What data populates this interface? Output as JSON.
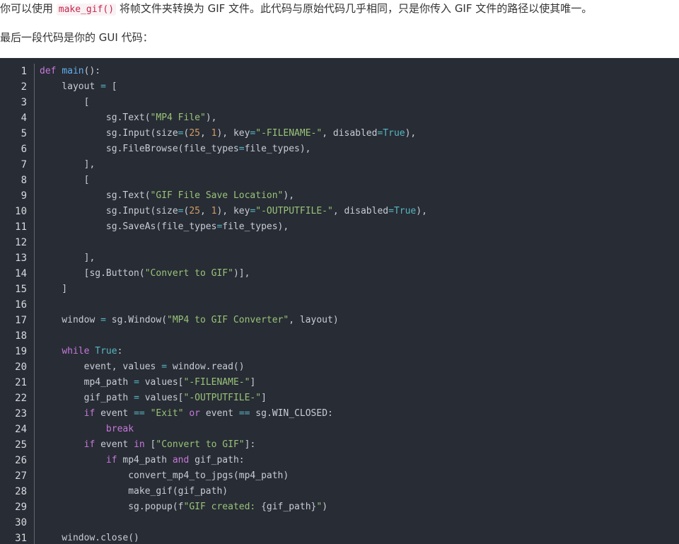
{
  "intro": {
    "before": "你可以使用 ",
    "code": "make_gif()",
    "after": " 将帧文件夹转换为 GIF 文件。此代码与原始代码几乎相同，只是你传入 GIF 文件的路径以使其唯一。"
  },
  "lead": "最后一段代码是你的 GUI 代码：",
  "code_lines": [
    [
      [
        "kw",
        "def"
      ],
      [
        "t",
        " "
      ],
      [
        "fn",
        "main"
      ],
      [
        "t",
        "():"
      ]
    ],
    [
      [
        "t",
        "    layout "
      ],
      [
        "op",
        "="
      ],
      [
        "t",
        " ["
      ]
    ],
    [
      [
        "t",
        "        ["
      ]
    ],
    [
      [
        "t",
        "            sg.Text("
      ],
      [
        "str",
        "\"MP4 File\""
      ],
      [
        "t",
        "),"
      ]
    ],
    [
      [
        "t",
        "            sg.Input(size"
      ],
      [
        "op",
        "="
      ],
      [
        "t",
        "("
      ],
      [
        "num",
        "25"
      ],
      [
        "t",
        ", "
      ],
      [
        "num",
        "1"
      ],
      [
        "t",
        "), key"
      ],
      [
        "op",
        "="
      ],
      [
        "str",
        "\"-FILENAME-\""
      ],
      [
        "t",
        ", disabled"
      ],
      [
        "op",
        "="
      ],
      [
        "bool",
        "True"
      ],
      [
        "t",
        "),"
      ]
    ],
    [
      [
        "t",
        "            sg.FileBrowse(file_types"
      ],
      [
        "op",
        "="
      ],
      [
        "t",
        "file_types),"
      ]
    ],
    [
      [
        "t",
        "        ],"
      ]
    ],
    [
      [
        "t",
        "        ["
      ]
    ],
    [
      [
        "t",
        "            sg.Text("
      ],
      [
        "str",
        "\"GIF File Save Location\""
      ],
      [
        "t",
        "),"
      ]
    ],
    [
      [
        "t",
        "            sg.Input(size"
      ],
      [
        "op",
        "="
      ],
      [
        "t",
        "("
      ],
      [
        "num",
        "25"
      ],
      [
        "t",
        ", "
      ],
      [
        "num",
        "1"
      ],
      [
        "t",
        "), key"
      ],
      [
        "op",
        "="
      ],
      [
        "str",
        "\"-OUTPUTFILE-\""
      ],
      [
        "t",
        ", disabled"
      ],
      [
        "op",
        "="
      ],
      [
        "bool",
        "True"
      ],
      [
        "t",
        "),"
      ]
    ],
    [
      [
        "t",
        "            sg.SaveAs(file_types"
      ],
      [
        "op",
        "="
      ],
      [
        "t",
        "file_types),"
      ]
    ],
    [
      [
        "t",
        ""
      ]
    ],
    [
      [
        "t",
        "        ],"
      ]
    ],
    [
      [
        "t",
        "        [sg.Button("
      ],
      [
        "str",
        "\"Convert to GIF\""
      ],
      [
        "t",
        ")],"
      ]
    ],
    [
      [
        "t",
        "    ]"
      ]
    ],
    [
      [
        "t",
        ""
      ]
    ],
    [
      [
        "t",
        "    window "
      ],
      [
        "op",
        "="
      ],
      [
        "t",
        " sg.Window("
      ],
      [
        "str",
        "\"MP4 to GIF Converter\""
      ],
      [
        "t",
        ", layout)"
      ]
    ],
    [
      [
        "t",
        ""
      ]
    ],
    [
      [
        "t",
        "    "
      ],
      [
        "kw",
        "while"
      ],
      [
        "t",
        " "
      ],
      [
        "bool",
        "True"
      ],
      [
        "t",
        ":"
      ]
    ],
    [
      [
        "t",
        "        event, values "
      ],
      [
        "op",
        "="
      ],
      [
        "t",
        " window.read()"
      ]
    ],
    [
      [
        "t",
        "        mp4_path "
      ],
      [
        "op",
        "="
      ],
      [
        "t",
        " values["
      ],
      [
        "str",
        "\"-FILENAME-\""
      ],
      [
        "t",
        "]"
      ]
    ],
    [
      [
        "t",
        "        gif_path "
      ],
      [
        "op",
        "="
      ],
      [
        "t",
        " values["
      ],
      [
        "str",
        "\"-OUTPUTFILE-\""
      ],
      [
        "t",
        "]"
      ]
    ],
    [
      [
        "t",
        "        "
      ],
      [
        "kw",
        "if"
      ],
      [
        "t",
        " event "
      ],
      [
        "op",
        "=="
      ],
      [
        "t",
        " "
      ],
      [
        "str",
        "\"Exit\""
      ],
      [
        "t",
        " "
      ],
      [
        "kw",
        "or"
      ],
      [
        "t",
        " event "
      ],
      [
        "op",
        "=="
      ],
      [
        "t",
        " sg.WIN_CLOSED:"
      ]
    ],
    [
      [
        "t",
        "            "
      ],
      [
        "kw",
        "break"
      ]
    ],
    [
      [
        "t",
        "        "
      ],
      [
        "kw",
        "if"
      ],
      [
        "t",
        " event "
      ],
      [
        "kw",
        "in"
      ],
      [
        "t",
        " ["
      ],
      [
        "str",
        "\"Convert to GIF\""
      ],
      [
        "t",
        "]:"
      ]
    ],
    [
      [
        "t",
        "            "
      ],
      [
        "kw",
        "if"
      ],
      [
        "t",
        " mp4_path "
      ],
      [
        "kw",
        "and"
      ],
      [
        "t",
        " gif_path:"
      ]
    ],
    [
      [
        "t",
        "                convert_mp4_to_jpgs(mp4_path)"
      ]
    ],
    [
      [
        "t",
        "                make_gif(gif_path)"
      ]
    ],
    [
      [
        "t",
        "                sg.popup(f"
      ],
      [
        "str",
        "\"GIF created: "
      ],
      [
        "t",
        "{gif_path}"
      ],
      [
        "str",
        "\""
      ],
      [
        "t",
        ")"
      ]
    ],
    [
      [
        "t",
        ""
      ]
    ],
    [
      [
        "t",
        "    window.close()"
      ]
    ]
  ],
  "colors": {
    "code_bg": "#282c34",
    "keyword": "#c678dd",
    "function": "#61afef",
    "string": "#98c379",
    "number": "#d19a66",
    "boolean": "#56b6c2",
    "text": "#c8ccd4"
  }
}
